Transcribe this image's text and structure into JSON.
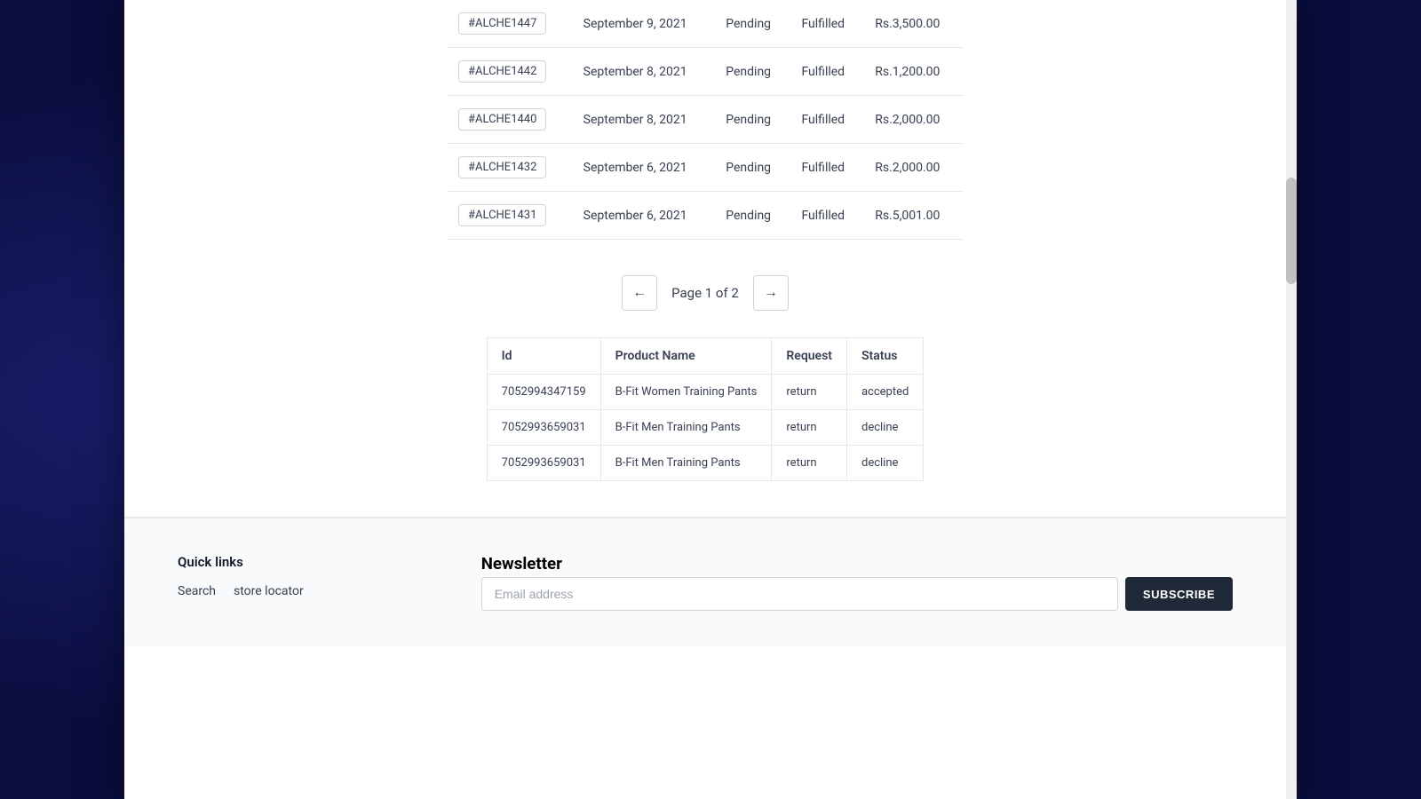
{
  "orders": {
    "rows": [
      {
        "id": "#ALCHE1447",
        "date": "September 9, 2021",
        "payment": "Pending",
        "fulfillment": "Fulfilled",
        "total": "Rs.3,500.00"
      },
      {
        "id": "#ALCHE1442",
        "date": "September 8, 2021",
        "payment": "Pending",
        "fulfillment": "Fulfilled",
        "total": "Rs.1,200.00"
      },
      {
        "id": "#ALCHE1440",
        "date": "September 8, 2021",
        "payment": "Pending",
        "fulfillment": "Fulfilled",
        "total": "Rs.2,000.00"
      },
      {
        "id": "#ALCHE1432",
        "date": "September 6, 2021",
        "payment": "Pending",
        "fulfillment": "Fulfilled",
        "total": "Rs.2,000.00"
      },
      {
        "id": "#ALCHE1431",
        "date": "September 6, 2021",
        "payment": "Pending",
        "fulfillment": "Fulfilled",
        "total": "Rs.5,001.00"
      }
    ]
  },
  "pagination": {
    "prev_label": "←",
    "next_label": "→",
    "page_text": "Page 1 of 2"
  },
  "returns_table": {
    "headers": [
      "Id",
      "Product Name",
      "Request",
      "Status"
    ],
    "rows": [
      {
        "id": "7052994347159",
        "product": "B-Fit Women Training Pants",
        "request": "return",
        "status": "accepted"
      },
      {
        "id": "7052993659031",
        "product": "B-Fit Men Training Pants",
        "request": "return",
        "status": "decline"
      },
      {
        "id": "7052993659031",
        "product": "B-Fit Men Training Pants",
        "request": "return",
        "status": "decline"
      }
    ]
  },
  "footer": {
    "quick_links_title": "Quick links",
    "links": [
      {
        "label": "Search"
      },
      {
        "label": "store locator"
      }
    ],
    "newsletter_title": "Newsletter",
    "email_placeholder": "Email address",
    "subscribe_label": "SUBSCRIBE"
  }
}
